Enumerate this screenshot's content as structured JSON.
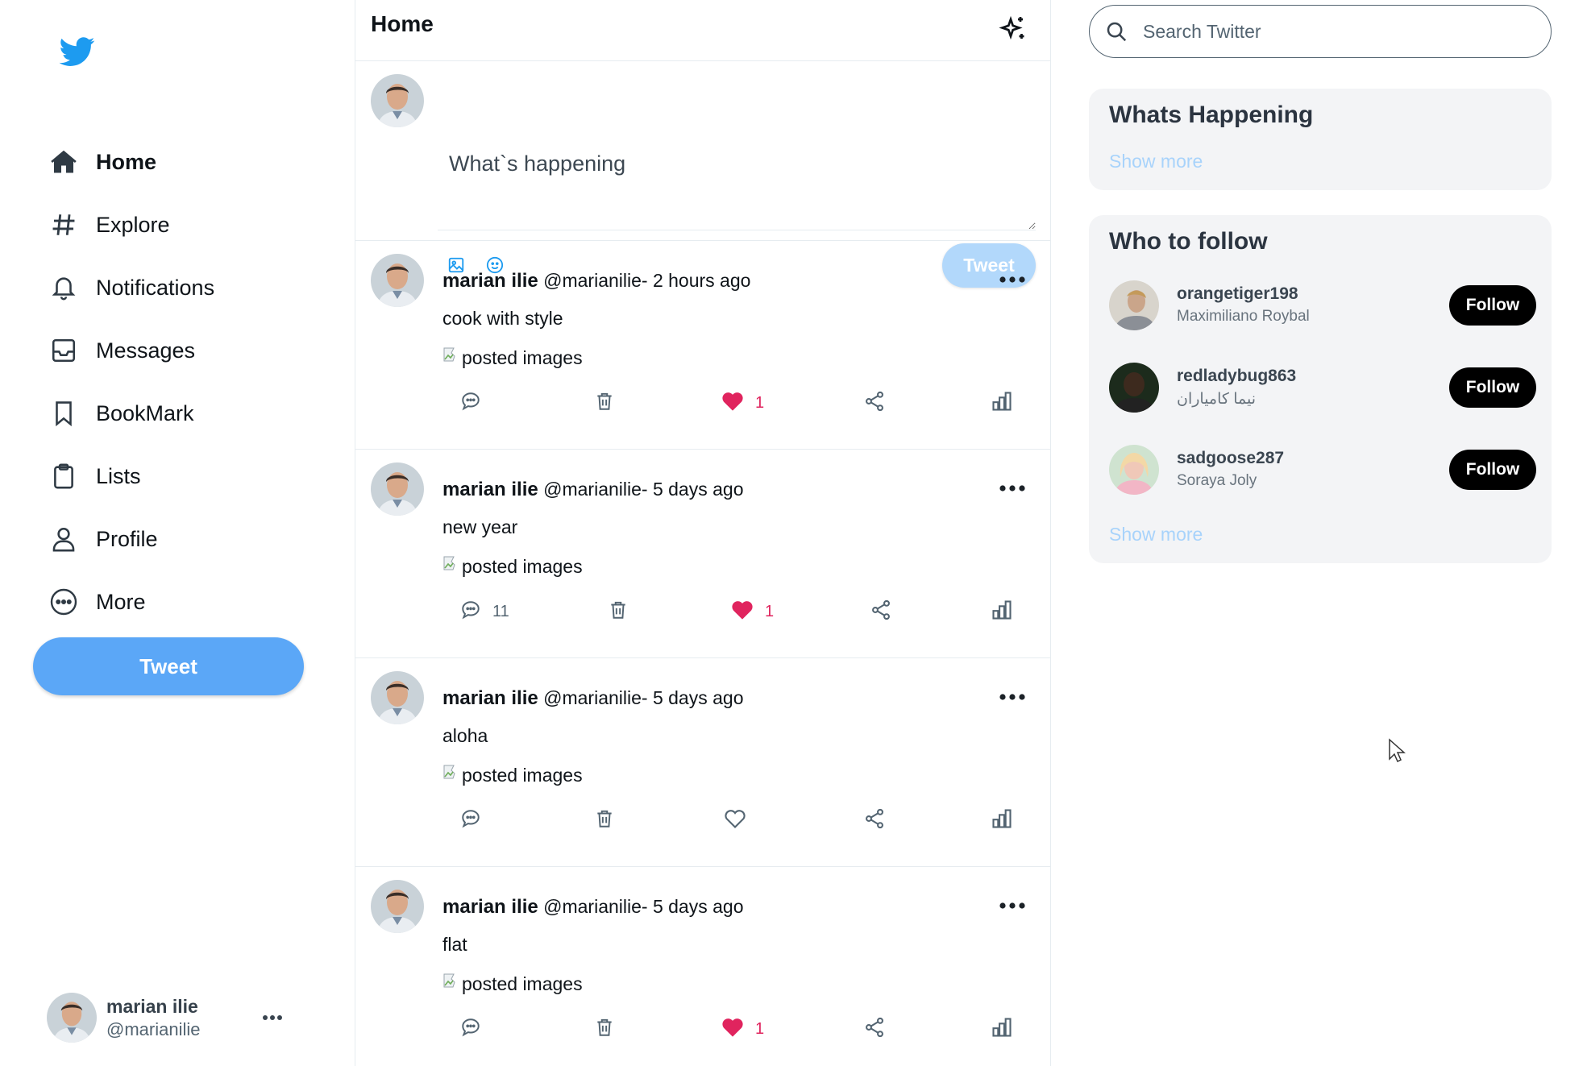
{
  "sidebar": {
    "logo": "twitter-bird",
    "nav": [
      {
        "label": "Home",
        "icon": "home-icon",
        "active": true
      },
      {
        "label": "Explore",
        "icon": "hashtag-icon"
      },
      {
        "label": "Notifications",
        "icon": "bell-icon"
      },
      {
        "label": "Messages",
        "icon": "inbox-icon"
      },
      {
        "label": "BookMark",
        "icon": "bookmark-icon"
      },
      {
        "label": "Lists",
        "icon": "clipboard-icon"
      },
      {
        "label": "Profile",
        "icon": "user-icon"
      },
      {
        "label": "More",
        "icon": "more-circle-icon"
      }
    ],
    "tweet_button": "Tweet",
    "account": {
      "name": "marian ilie",
      "handle": "@marianilie"
    }
  },
  "main": {
    "title": "Home",
    "compose": {
      "placeholder": "What`s happening",
      "tweet_button": "Tweet"
    },
    "tweets": [
      {
        "name": "marian ilie",
        "handle": "@marianilie-",
        "time": "2 hours ago",
        "text": "cook with style",
        "image_alt": "posted images",
        "comments": "",
        "likes": "1",
        "liked": true
      },
      {
        "name": "marian ilie",
        "handle": "@marianilie-",
        "time": "5 days ago",
        "text": "new year",
        "image_alt": "posted images",
        "comments": "11",
        "likes": "1",
        "liked": true
      },
      {
        "name": "marian ilie",
        "handle": "@marianilie-",
        "time": "5 days ago",
        "text": "aloha",
        "image_alt": "posted images",
        "comments": "",
        "likes": "",
        "liked": false
      },
      {
        "name": "marian ilie",
        "handle": "@marianilie-",
        "time": "5 days ago",
        "text": "flat",
        "image_alt": "posted images",
        "comments": "",
        "likes": "1",
        "liked": true
      }
    ]
  },
  "right": {
    "search_placeholder": "Search Twitter",
    "happening": {
      "title": "Whats Happening",
      "show_more": "Show more"
    },
    "who_to_follow": {
      "title": "Who to follow",
      "users": [
        {
          "username": "orangetiger198",
          "name": "Maximiliano Roybal",
          "button": "Follow"
        },
        {
          "username": "redladybug863",
          "name": "نیما کامیاران",
          "button": "Follow"
        },
        {
          "username": "sadgoose287",
          "name": "Soraya Joly",
          "button": "Follow"
        }
      ],
      "show_more": "Show more"
    }
  },
  "colors": {
    "brand": "#1d9bf0",
    "tweet_button": "#5ba7f7",
    "like": "#e0245e",
    "show_more": "#a8d3fb"
  }
}
